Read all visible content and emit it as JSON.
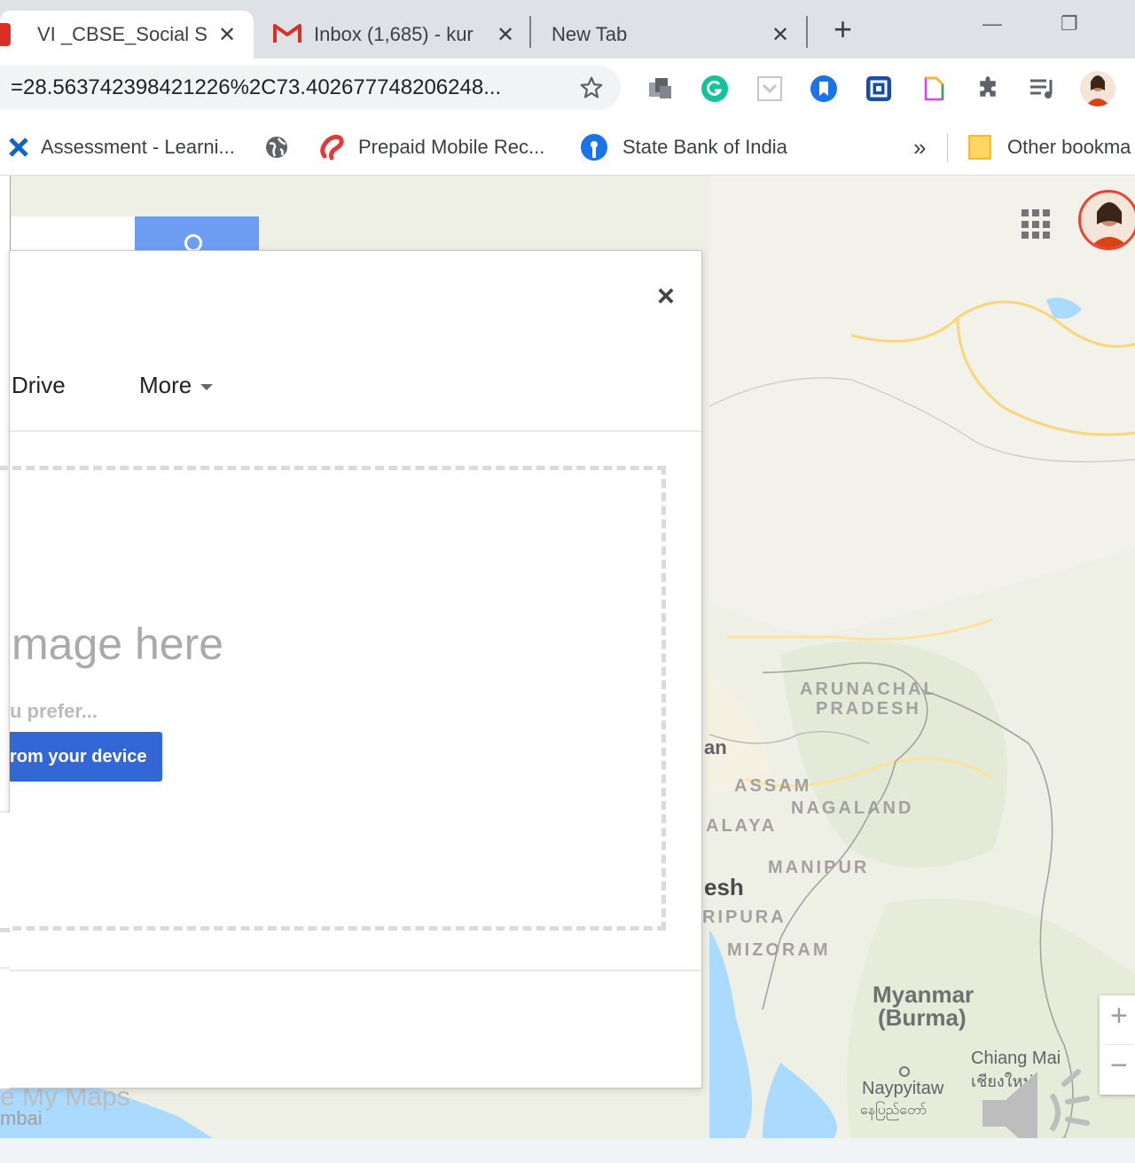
{
  "tabs": [
    {
      "title": "VI _CBSE_Social St",
      "icon": "pdf-icon",
      "active": true
    },
    {
      "title": "Inbox (1,685) - kur",
      "icon": "gmail-icon",
      "active": false
    },
    {
      "title": "New Tab",
      "icon": "",
      "active": false
    }
  ],
  "new_tab_label": "+",
  "window_controls": {
    "minimize": "—",
    "restore": "❐"
  },
  "address_bar": {
    "url": "=28.563742398421226%2C73.402677748206248..."
  },
  "bookmarks": [
    {
      "label": "Assessment - Learni...",
      "icon": "assessment-icon"
    },
    {
      "label": "",
      "icon": "globe-icon"
    },
    {
      "label": "Prepaid Mobile Rec...",
      "icon": "airtel-icon"
    },
    {
      "label": "State Bank of India",
      "icon": "sbi-icon"
    }
  ],
  "bookmarks_overflow": "»",
  "other_bookmarks": "Other bookma",
  "dialog": {
    "close_label": "×",
    "tabs": [
      "Drive",
      "More"
    ],
    "drop_title": "mage here",
    "drop_subtitle": "u prefer...",
    "upload_button": "rom your device"
  },
  "map": {
    "labels": {
      "arunachal": "ARUNACHAL",
      "pradesh": "PRADESH",
      "assam": "ASSAM",
      "nagaland": "NAGALAND",
      "meghalaya": "ALAYA",
      "manipur": "MANIPUR",
      "tripura": "RIPURA",
      "mizoram": "MIZORAM",
      "bangladesh": "esh",
      "bhutan": "an",
      "myanmar1": "Myanmar",
      "myanmar2": "(Burma)",
      "chiang_mai": "Chiang Mai",
      "chiang_mai_thai": "เชียงใหม่",
      "naypyitaw": "Naypyitaw",
      "naypyitaw_local": "နေပြည်တော်",
      "my_maps": "e My Maps",
      "mumbai": "mbai"
    },
    "zoom_in": "+",
    "zoom_out": "−"
  },
  "colors": {
    "tab_strip": "#dee1e6",
    "accent_blue": "#4285f4",
    "upload_blue": "#3367d6",
    "map_bg": "#eef0e8"
  }
}
